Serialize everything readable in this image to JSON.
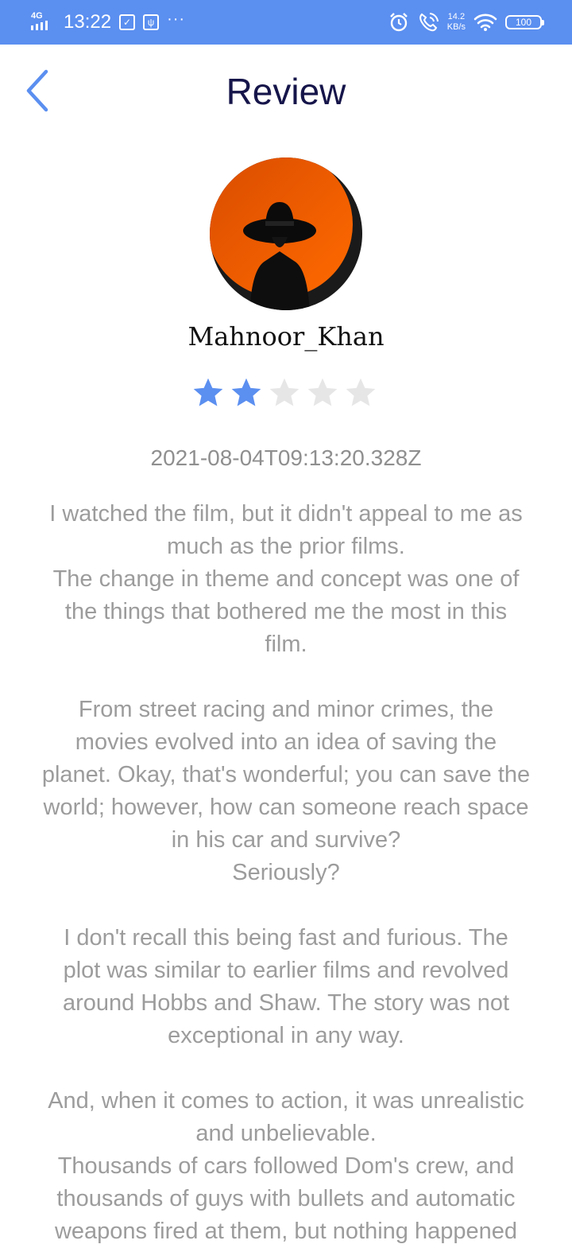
{
  "status_bar": {
    "network": "4G",
    "time": "13:22",
    "overflow": "···",
    "speed_value": "14.2",
    "speed_unit": "KB/s",
    "battery": "100"
  },
  "header": {
    "title": "Review",
    "back_icon": "chevron-left-icon"
  },
  "review": {
    "username": "Mahnoor_Khan",
    "rating": 2,
    "rating_max": 5,
    "timestamp": "2021-08-04T09:13:20.328Z",
    "paragraphs": [
      [
        "I watched the film, but it didn't appeal to me as",
        "much as the prior films.",
        "The change in theme and concept was one of",
        "the things that bothered me the most in this",
        "film."
      ],
      [
        "From street racing and minor crimes, the",
        "movies evolved into an idea of saving the",
        "planet. Okay, that's wonderful; you can save the",
        "world; however, how can someone reach space",
        "in his car and survive?",
        "Seriously?"
      ],
      [
        "I don't recall this being fast and furious. The",
        "plot was similar to earlier films and revolved",
        "around Hobbs and Shaw. The story was not",
        "exceptional in any way."
      ],
      [
        "And, when it comes to action, it was unrealistic",
        "and unbelievable.",
        "Thousands of cars followed Dom's crew, and",
        "thousands of guys with bullets and automatic",
        "weapons fired at them, but nothing happened"
      ]
    ]
  },
  "colors": {
    "status_bar": "#5b8ff0",
    "accent": "#5b8ff0",
    "title": "#16154a",
    "star_filled": "#5b8ff0",
    "star_empty": "#e6e6e6",
    "text_muted": "#9c9c9c"
  }
}
